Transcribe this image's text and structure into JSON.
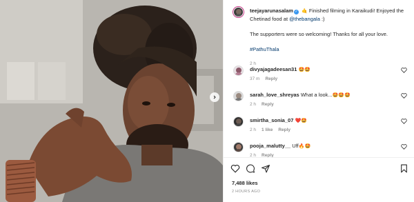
{
  "post": {
    "username": "teejayarunasalam",
    "caption_line1_pre": "Finished filming in Karaikudi! Enjoyed the Chetinad food at ",
    "caption_mention": "@thebangala",
    "caption_line1_post": " :)",
    "caption_line2": "The supporters were so welcoming! Thanks for all your love.",
    "hashtag": "#PathuThala",
    "time": "2 h"
  },
  "comments": [
    {
      "username": "divyajagadeesan31",
      "text": "",
      "emojis": "🤩🤩",
      "time": "37 m",
      "likes": "",
      "reply": "Reply"
    },
    {
      "username": "sarah_love_shreyas",
      "text": "What a look...",
      "emojis": "🤩🤩🤩",
      "time": "2 h",
      "likes": "",
      "reply": "Reply"
    },
    {
      "username": "smirtha_sonia_07",
      "text": "",
      "emojis": "❤️🤩",
      "time": "2 h",
      "likes": "1 like",
      "reply": "Reply"
    },
    {
      "username": "pooja_malutty__",
      "text": "Uff",
      "emojis": "🔥🤩",
      "time": "2 h",
      "likes": "",
      "reply": "Reply"
    }
  ],
  "footer": {
    "likes": "7,488 likes",
    "posted_ago": "2 HOURS AGO"
  },
  "colors": {
    "link": "#00376b",
    "verified": "#3897f0",
    "muted": "#8e8e8e"
  }
}
